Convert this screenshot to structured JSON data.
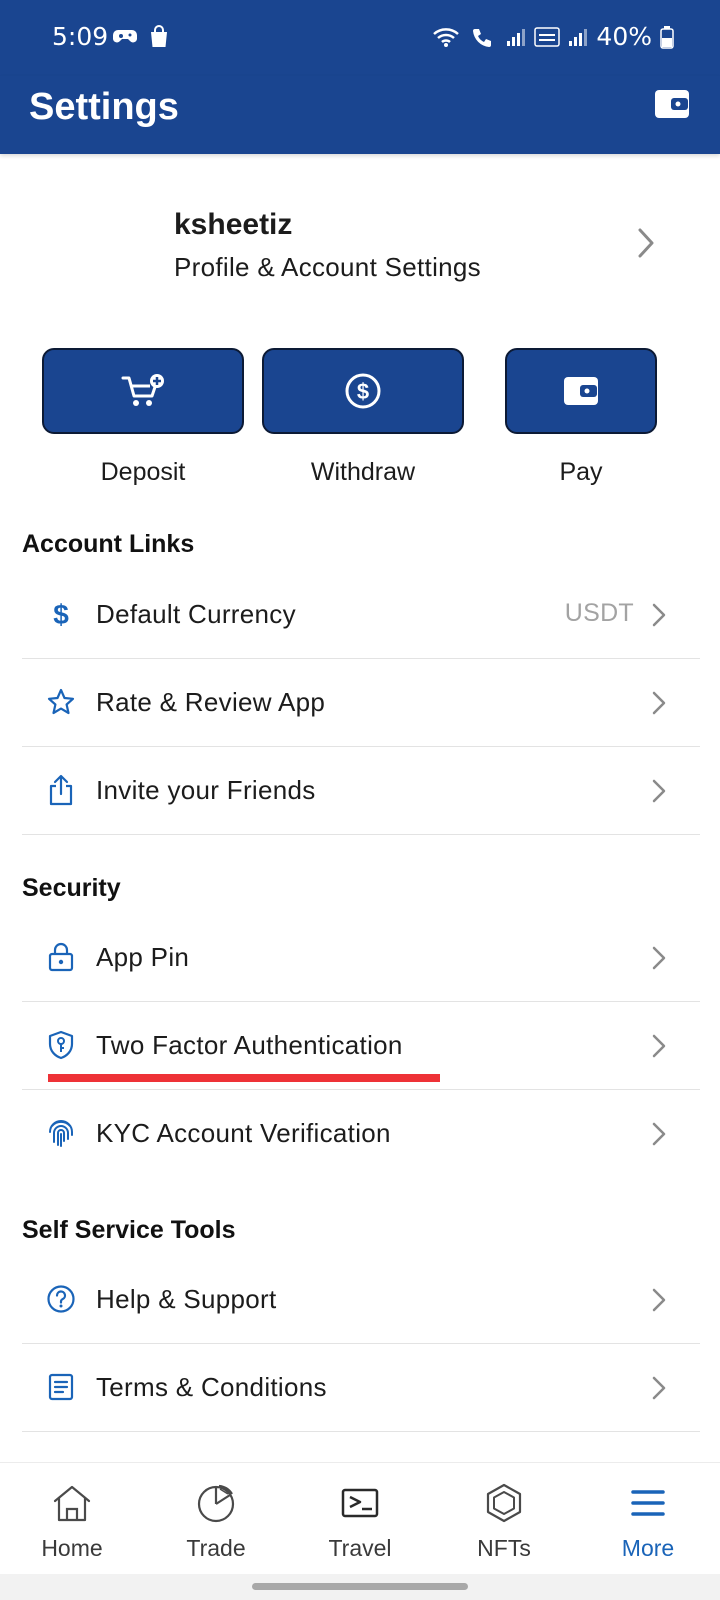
{
  "status_bar": {
    "time": "5:09",
    "battery": "40%"
  },
  "header": {
    "title": "Settings",
    "icon": "wallet-icon"
  },
  "profile": {
    "username": "ksheetiz",
    "subtitle": "Profile & Account Settings"
  },
  "actions": [
    {
      "label": "Deposit",
      "icon": "cart-add-icon"
    },
    {
      "label": "Withdraw",
      "icon": "dollar-circle-icon"
    },
    {
      "label": "Pay",
      "icon": "wallet-icon"
    }
  ],
  "sections": {
    "account_links": {
      "title": "Account Links",
      "items": [
        {
          "label": "Default Currency",
          "value": "USDT",
          "icon": "dollar-icon"
        },
        {
          "label": "Rate & Review App",
          "icon": "star-icon"
        },
        {
          "label": "Invite your Friends",
          "icon": "share-icon"
        }
      ]
    },
    "security": {
      "title": "Security",
      "items": [
        {
          "label": "App Pin",
          "icon": "lock-icon"
        },
        {
          "label": "Two Factor Authentication",
          "icon": "shield-key-icon"
        },
        {
          "label": "KYC Account Verification",
          "icon": "fingerprint-icon"
        }
      ]
    },
    "self_service": {
      "title": "Self Service Tools",
      "items": [
        {
          "label": "Help & Support",
          "icon": "help-circle-icon"
        },
        {
          "label": "Terms & Conditions",
          "icon": "document-icon"
        }
      ]
    }
  },
  "bottom_nav": [
    {
      "label": "Home",
      "icon": "home-icon"
    },
    {
      "label": "Trade",
      "icon": "pie-chart-icon"
    },
    {
      "label": "Travel",
      "icon": "ticket-icon"
    },
    {
      "label": "NFTs",
      "icon": "hexagon-icon"
    },
    {
      "label": "More",
      "icon": "menu-icon",
      "active": true
    }
  ],
  "colors": {
    "brand": "#1a4590",
    "accent": "#1a64b8",
    "highlight": "#ee3237",
    "muted": "#a3a3a3"
  }
}
